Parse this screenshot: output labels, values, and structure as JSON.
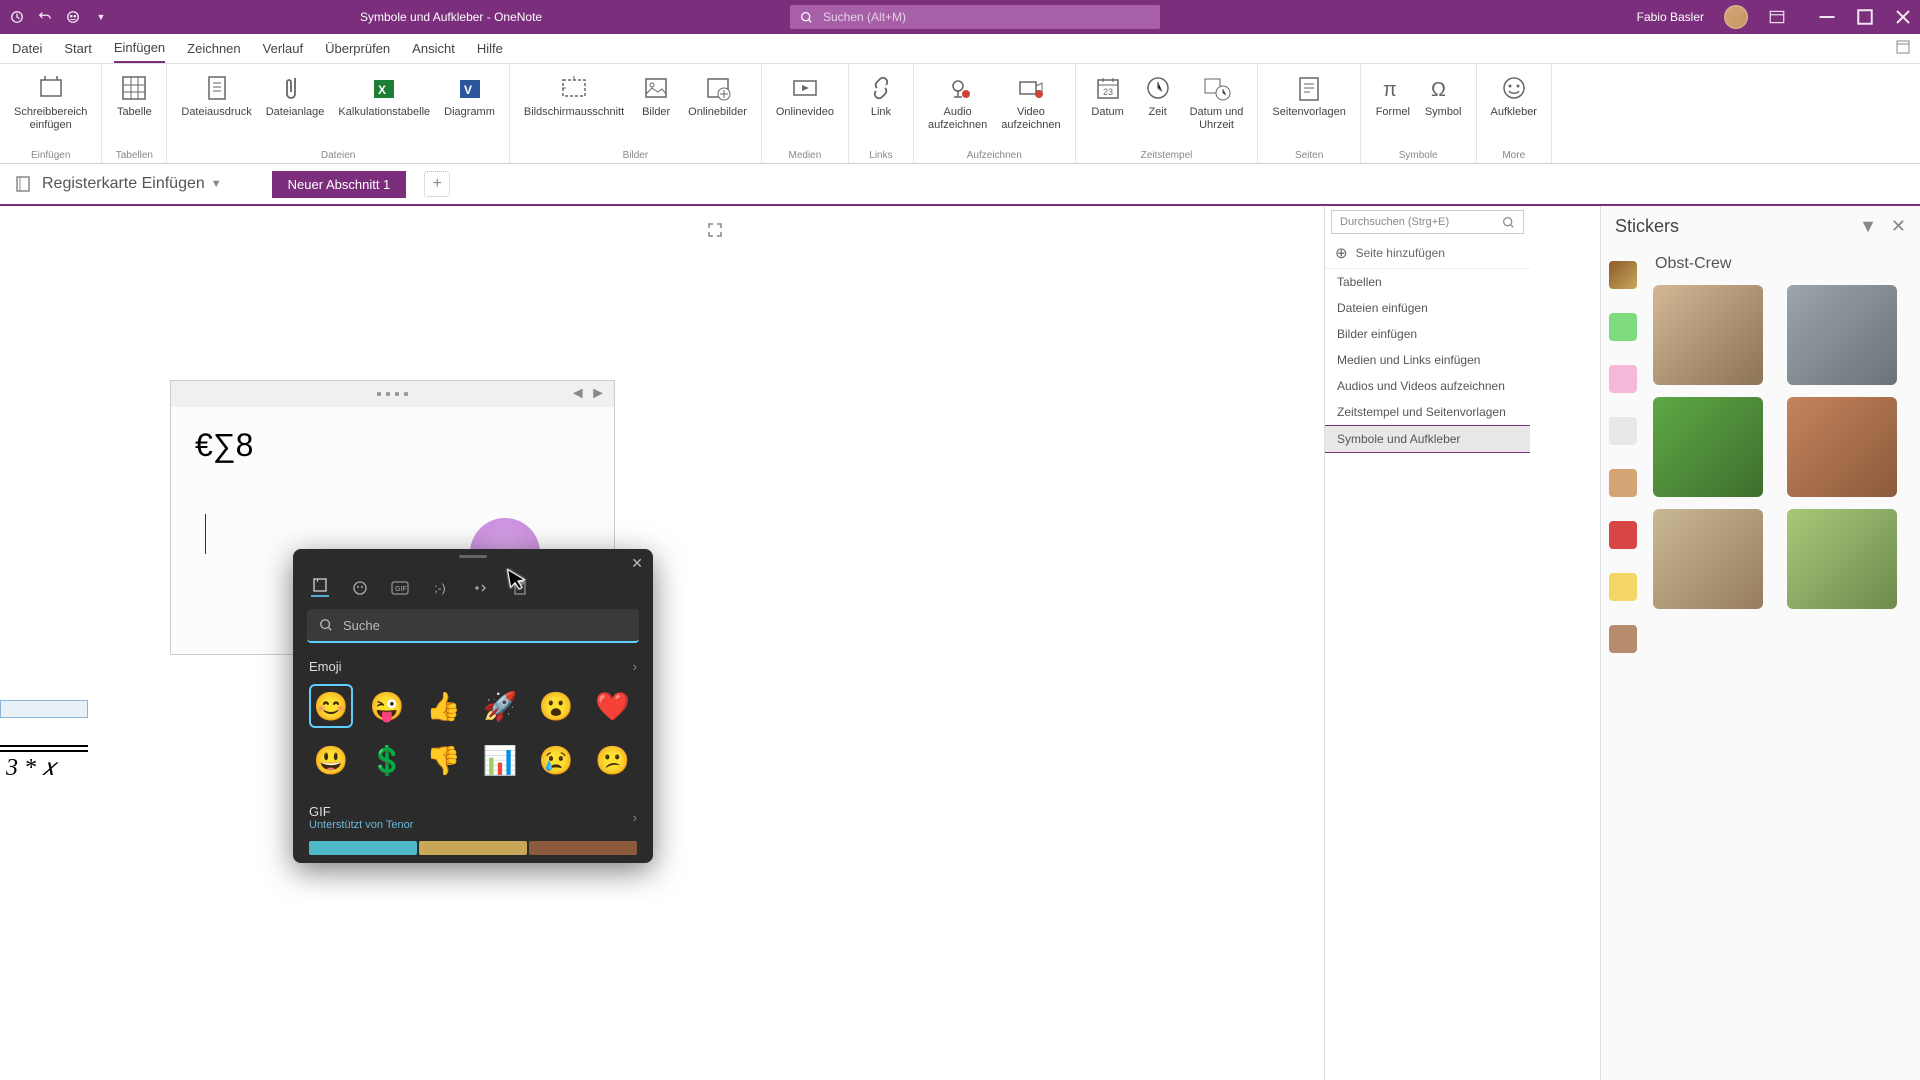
{
  "titlebar": {
    "title": "Symbole und Aufkleber  -  OneNote",
    "search_placeholder": "Suchen (Alt+M)",
    "user": "Fabio Basler"
  },
  "menutabs": [
    "Datei",
    "Start",
    "Einfügen",
    "Zeichnen",
    "Verlauf",
    "Überprüfen",
    "Ansicht",
    "Hilfe"
  ],
  "menutabs_active": 2,
  "ribbon": [
    {
      "label": "Einfügen",
      "items": [
        {
          "label": "Schreibbereich\neinfügen",
          "icon": "insert-space"
        }
      ]
    },
    {
      "label": "Tabellen",
      "items": [
        {
          "label": "Tabelle",
          "icon": "table"
        }
      ]
    },
    {
      "label": "Dateien",
      "items": [
        {
          "label": "Dateiausdruck",
          "icon": "file-printout"
        },
        {
          "label": "Dateianlage",
          "icon": "attachment"
        },
        {
          "label": "Kalkulationstabelle",
          "icon": "spreadsheet"
        },
        {
          "label": "Diagramm",
          "icon": "visio"
        }
      ]
    },
    {
      "label": "Bilder",
      "items": [
        {
          "label": "Bildschirmausschnitt",
          "icon": "screenshot"
        },
        {
          "label": "Bilder",
          "icon": "picture"
        },
        {
          "label": "Onlinebilder",
          "icon": "online-picture"
        }
      ]
    },
    {
      "label": "Medien",
      "items": [
        {
          "label": "Onlinevideo",
          "icon": "video"
        }
      ]
    },
    {
      "label": "Links",
      "items": [
        {
          "label": "Link",
          "icon": "link"
        }
      ]
    },
    {
      "label": "Aufzeichnen",
      "items": [
        {
          "label": "Audio\naufzeichnen",
          "icon": "audio"
        },
        {
          "label": "Video\naufzeichnen",
          "icon": "video-record"
        }
      ]
    },
    {
      "label": "Zeitstempel",
      "items": [
        {
          "label": "Datum",
          "icon": "date"
        },
        {
          "label": "Zeit",
          "icon": "time"
        },
        {
          "label": "Datum und\nUhrzeit",
          "icon": "datetime"
        }
      ]
    },
    {
      "label": "Seiten",
      "items": [
        {
          "label": "Seitenvorlagen",
          "icon": "templates"
        }
      ]
    },
    {
      "label": "Symbole",
      "items": [
        {
          "label": "Formel",
          "icon": "equation"
        },
        {
          "label": "Symbol",
          "icon": "symbol"
        }
      ]
    },
    {
      "label": "More",
      "items": [
        {
          "label": "Aufkleber",
          "icon": "sticker"
        }
      ]
    }
  ],
  "notebook": {
    "name": "Registerkarte Einfügen",
    "section": "Neuer Abschnitt 1"
  },
  "note_content": "€∑8",
  "equation_fragment": "3 * 𝑥",
  "page_panel": {
    "search_placeholder": "Durchsuchen (Strg+E)",
    "add_label": "Seite hinzufügen",
    "pages": [
      "Tabellen",
      "Dateien einfügen",
      "Bilder einfügen",
      "Medien und Links einfügen",
      "Audios und Videos aufzeichnen",
      "Zeitstempel und Seitenvorlagen",
      "Symbole und Aufkleber"
    ],
    "active": 6
  },
  "stickers": {
    "header": "Stickers",
    "pack_title": "Obst-Crew",
    "category_colors": [
      "linear-gradient(135deg,#8b5a2b,#c8a858)",
      "#7edb7e",
      "#f5b8d8",
      "#e8e8e8",
      "#d4a574",
      "#d84545",
      "#f5d565",
      "#b88d6f"
    ],
    "items": [
      "linear-gradient(135deg,#d4b896,#8b7355)",
      "linear-gradient(135deg,#9ba5ab,#6b7378)",
      "linear-gradient(135deg,#5fa845,#3d6e2e)",
      "linear-gradient(135deg,#c4845c,#8b5a3c)",
      "linear-gradient(135deg,#cab896,#967d5c)",
      "linear-gradient(135deg,#a8c878,#6e8b4e)"
    ]
  },
  "emoji_picker": {
    "search_placeholder": "Suche",
    "emoji_label": "Emoji",
    "gif_label": "GIF",
    "gif_sublabel": "Unterstützt von Tenor",
    "emojis_row1": [
      "😊",
      "😜",
      "👍",
      "🚀",
      "😮",
      "❤️"
    ],
    "emojis_row2": [
      "😃",
      "💲",
      "👎",
      "📊",
      "😢",
      "😕"
    ]
  }
}
